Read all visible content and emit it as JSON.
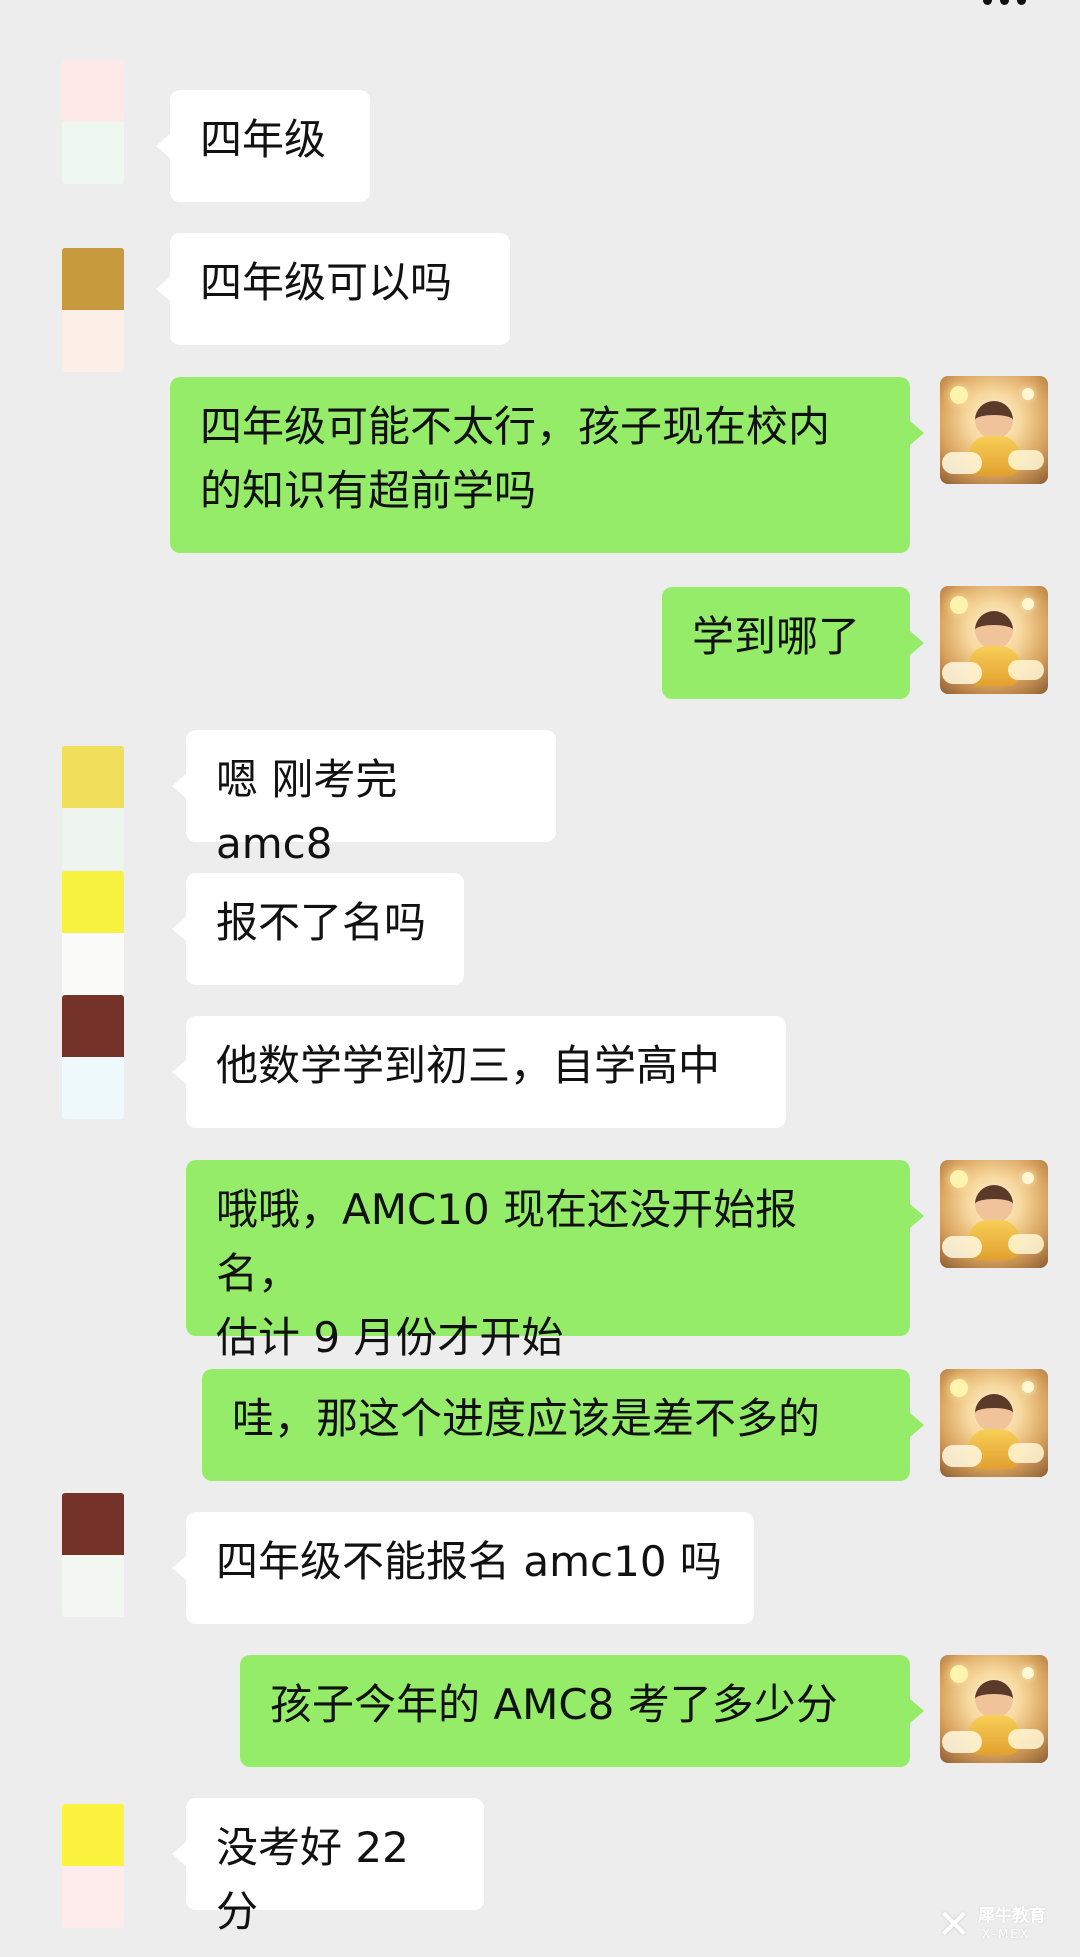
{
  "app": {
    "more_icon": "more-icon"
  },
  "messages": [
    {
      "side": "left",
      "text": "四年级",
      "avatar_colors": [
        "#fde9e7",
        "#eef8f1"
      ]
    },
    {
      "side": "left",
      "text": "四年级可以吗",
      "avatar_colors": [
        "#c79a3e",
        "#fbefe7"
      ]
    },
    {
      "side": "right",
      "text": "四年级可能不太行，孩子现在校内\n的知识有超前学吗",
      "avatar": "anime-girl-avatar"
    },
    {
      "side": "right",
      "text": "学到哪了",
      "avatar": "anime-girl-avatar"
    },
    {
      "side": "left",
      "text": "嗯 刚考完 amc8",
      "avatar_colors": [
        "#f1df5c",
        "#edf5ee"
      ]
    },
    {
      "side": "left",
      "text": "报不了名吗",
      "avatar_colors": [
        "#f7f23f",
        "#fbfbfa"
      ]
    },
    {
      "side": "left",
      "text": "他数学学到初三，自学高中",
      "avatar_colors": [
        "#743229",
        "#eefafb"
      ]
    },
    {
      "side": "right",
      "text": "哦哦，AMC10 现在还没开始报名，\n估计 9 月份才开始",
      "avatar": "anime-girl-avatar"
    },
    {
      "side": "right",
      "text": "哇，那这个进度应该是差不多的",
      "avatar": "anime-girl-avatar"
    },
    {
      "side": "left",
      "text": "四年级不能报名 amc10 吗",
      "avatar_colors": [
        "#743229",
        "#f2f8f1"
      ]
    },
    {
      "side": "right",
      "text": "孩子今年的 AMC8 考了多少分",
      "avatar": "anime-girl-avatar"
    },
    {
      "side": "left",
      "text": "没考好 22 分",
      "avatar_colors": [
        "#fbf33d",
        "#fdeceb"
      ]
    }
  ],
  "watermark": {
    "brand": "犀牛教育",
    "brand_en": "X-MEX"
  }
}
